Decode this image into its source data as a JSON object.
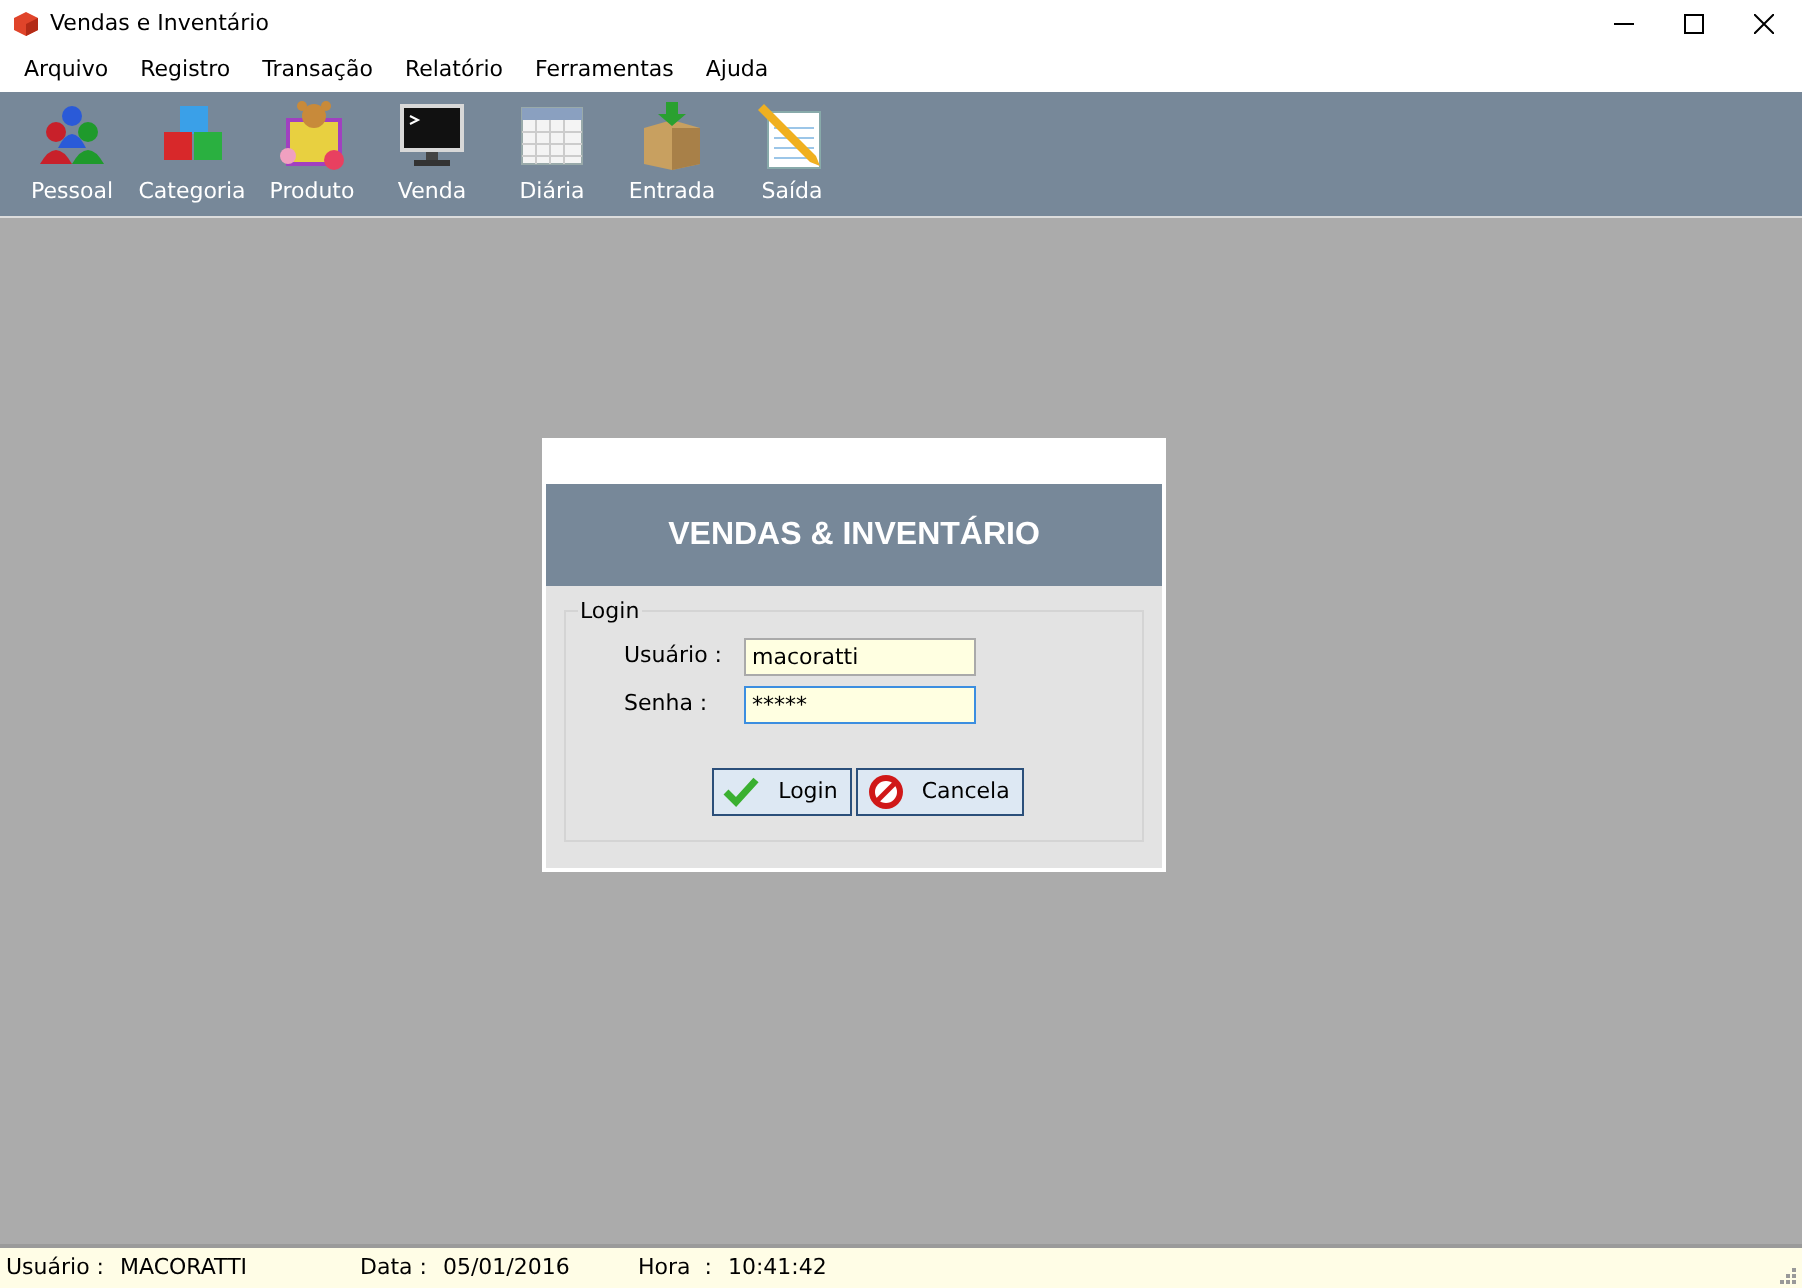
{
  "window": {
    "title": "Vendas e Inventário"
  },
  "menu": [
    "Arquivo",
    "Registro",
    "Transação",
    "Relatório",
    "Ferramentas",
    "Ajuda"
  ],
  "toolbar": [
    {
      "label": "Pessoal",
      "kind": "people"
    },
    {
      "label": "Categoria",
      "kind": "cubes"
    },
    {
      "label": "Produto",
      "kind": "toys"
    },
    {
      "label": "Venda",
      "kind": "monitor"
    },
    {
      "label": "Diária",
      "kind": "calendar"
    },
    {
      "label": "Entrada",
      "kind": "box"
    },
    {
      "label": "Saída",
      "kind": "notepad"
    }
  ],
  "login_dialog": {
    "heading": "VENDAS & INVENTÁRIO",
    "group": "Login",
    "fields": [
      {
        "label": "Usuário :",
        "value": "macoratti",
        "focused": false
      },
      {
        "label": "Senha :",
        "value": "*****",
        "focused": true
      }
    ],
    "buttons": [
      {
        "label": "Login",
        "kind": "ok"
      },
      {
        "label": "Cancela",
        "kind": "cancel"
      }
    ]
  },
  "status_bar": [
    {
      "label": "Usuário :",
      "value": "MACORATTI"
    },
    {
      "label": "Data :",
      "value": "05/01/2016"
    },
    {
      "label": "Hora  :",
      "value": "10:41:42"
    }
  ]
}
